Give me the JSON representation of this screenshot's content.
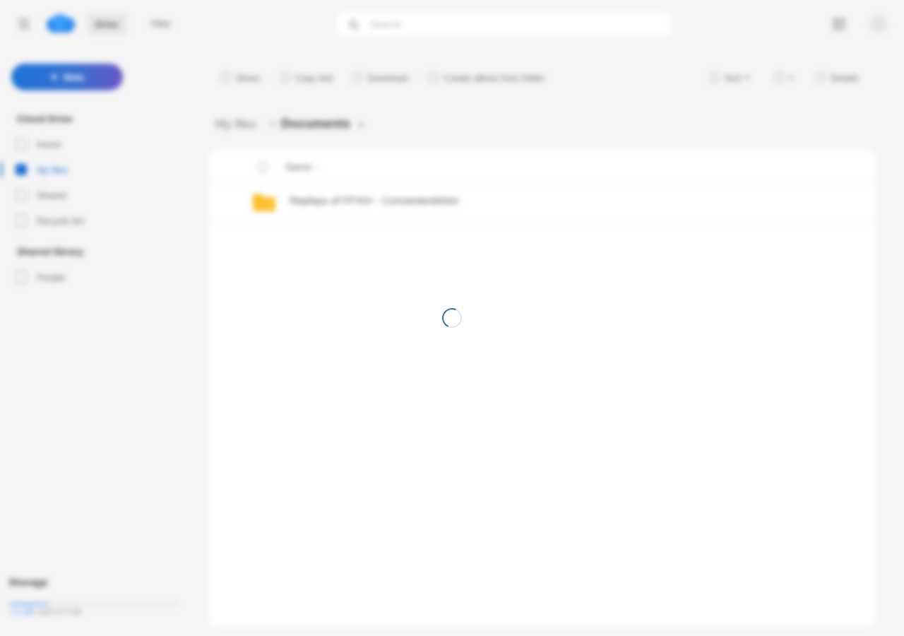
{
  "header": {
    "tabs": [
      {
        "label": "Drive",
        "active": true
      },
      {
        "label": "Files",
        "active": false
      }
    ],
    "search": {
      "placeholder": "Search"
    }
  },
  "sidebar": {
    "new_button_label": "New",
    "section_main": "Cloud Drive",
    "items": [
      {
        "label": "Home",
        "active": false,
        "icon": "home-icon"
      },
      {
        "label": "My files",
        "active": true,
        "icon": "folder-icon"
      },
      {
        "label": "Shared",
        "active": false,
        "icon": "share-icon"
      },
      {
        "label": "Recycle bin",
        "active": false,
        "icon": "trash-icon"
      }
    ],
    "section_shared": "Shared library",
    "shared_items": [
      {
        "label": "People",
        "icon": "people-icon"
      }
    ],
    "storage": {
      "title": "Storage",
      "used": "1.2 GB",
      "rest": "used of 5 GB",
      "used_fraction": 0.24
    }
  },
  "toolbar": {
    "actions": [
      "Share",
      "Copy link",
      "Download",
      "Create album from folder"
    ],
    "right": {
      "sort": "Sort",
      "view": "List",
      "details": "Details"
    }
  },
  "breadcrumb": {
    "root": "My files",
    "separator": ">",
    "current": "Documents"
  },
  "file_list": {
    "header": {
      "name": "Name",
      "sort_indicator": "↓"
    },
    "rows": [
      {
        "name": "Replays of FFXIV - Convenientshire",
        "type": "folder"
      }
    ]
  },
  "status": {
    "loading": true
  },
  "colors": {
    "accent": "#1a6fd3",
    "folder": "#fbc02d",
    "spinner": "#2f6ea6"
  }
}
